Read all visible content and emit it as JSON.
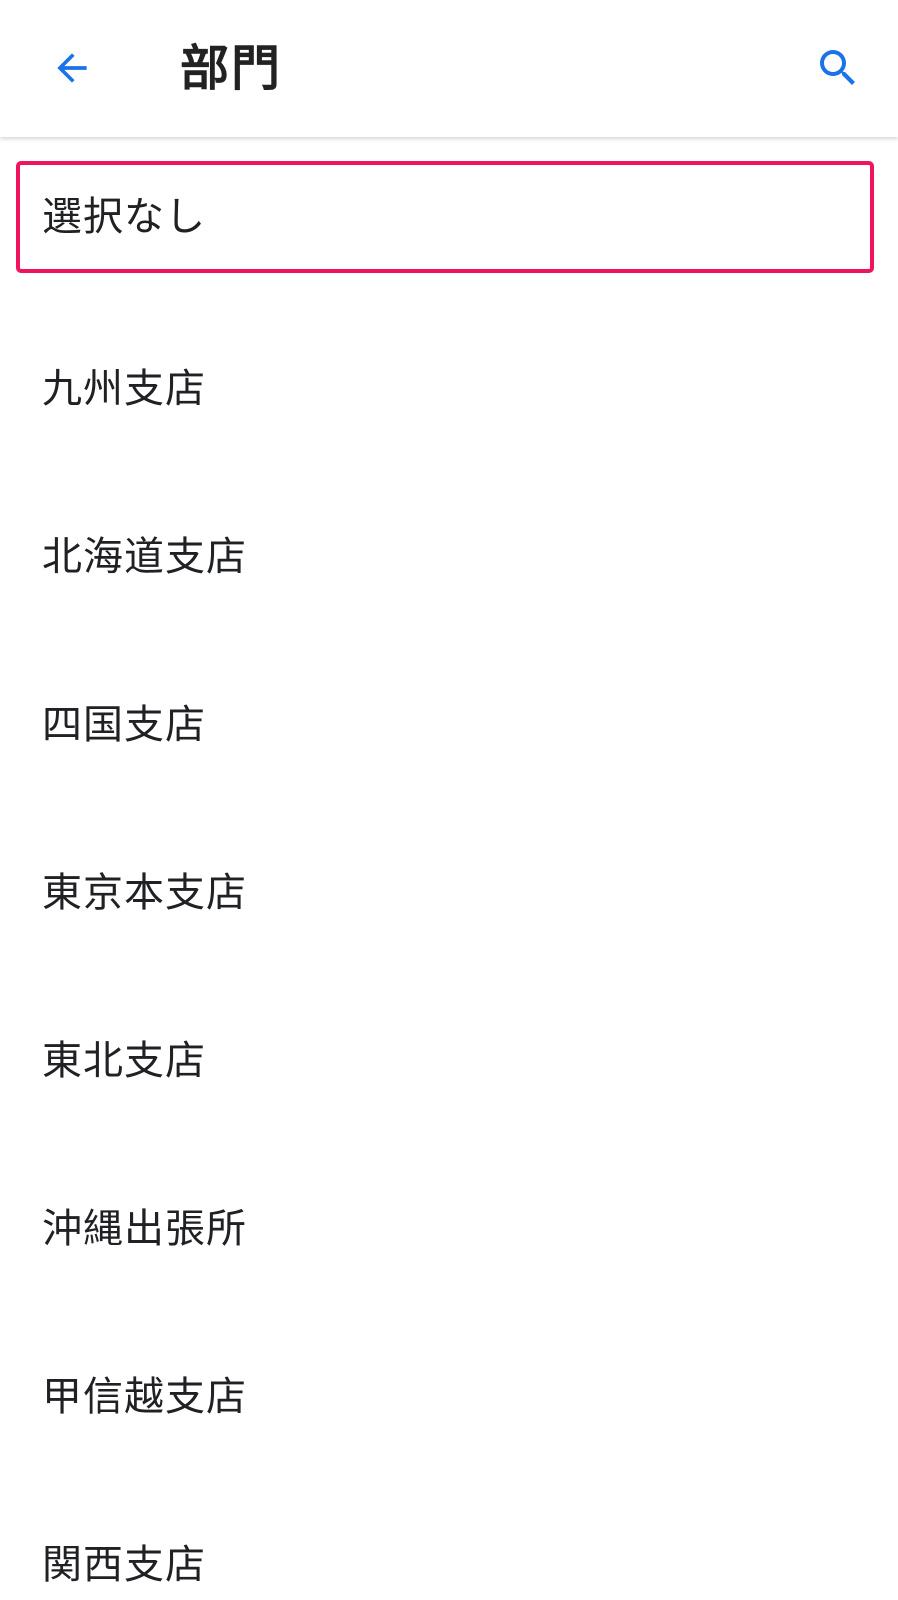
{
  "app_bar": {
    "title": "部門",
    "back_icon": "arrow-left-icon",
    "search_icon": "search-icon",
    "accent_color": "#1a73e8"
  },
  "highlight": {
    "color": "#f0145f"
  },
  "list": {
    "items": [
      {
        "label": "選択なし"
      },
      {
        "label": "九州支店"
      },
      {
        "label": "北海道支店"
      },
      {
        "label": "四国支店"
      },
      {
        "label": "東京本支店"
      },
      {
        "label": "東北支店"
      },
      {
        "label": "沖縄出張所"
      },
      {
        "label": "甲信越支店"
      },
      {
        "label": "関西支店"
      }
    ]
  }
}
